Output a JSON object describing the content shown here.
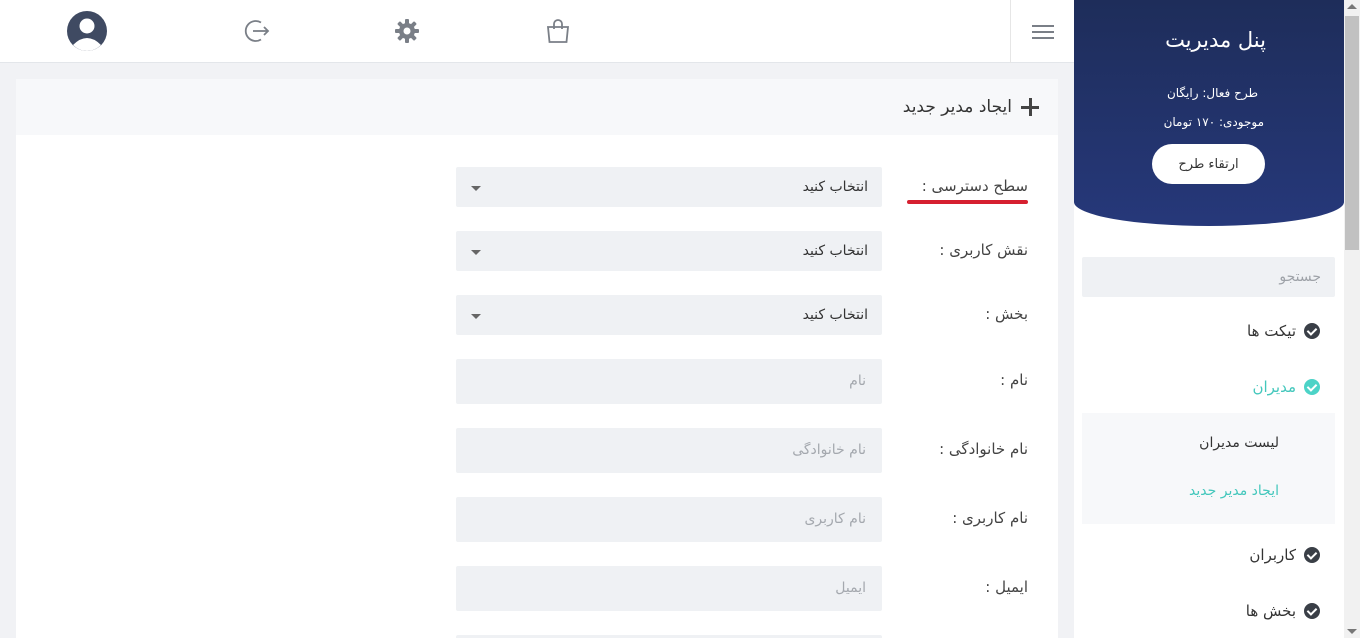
{
  "topbar": {
    "icons": [
      "avatar-icon",
      "logout-icon",
      "gear-icon",
      "shopping-bag-icon",
      "hamburger-icon"
    ]
  },
  "card": {
    "title": "ایجاد مدیر جدید",
    "fields": {
      "access_level": {
        "label": "سطح دسترسی :",
        "value": "انتخاب کنید"
      },
      "user_role": {
        "label": "نقش کاربری :",
        "value": "انتخاب کنید"
      },
      "section": {
        "label": "بخش :",
        "value": "انتخاب کنید"
      },
      "first_name": {
        "label": "نام :",
        "placeholder": "نام"
      },
      "last_name": {
        "label": "نام خانوادگی :",
        "placeholder": "نام خانوادگی"
      },
      "username": {
        "label": "نام کاربری :",
        "placeholder": "نام کاربری"
      },
      "email": {
        "label": "ایمیل :",
        "placeholder": "ایمیل"
      }
    }
  },
  "sidebar": {
    "title": "پنل مدیریت",
    "plan": "طرح فعال: رایگان",
    "balance": "موجودی: ۱۷۰ تومان",
    "upgrade_label": "ارتقاء طرح",
    "search_placeholder": "جستجو",
    "items": {
      "tickets": "تیکت ها",
      "admins": "مدیران",
      "admins_list": "لیست مدیران",
      "create_admin": "ایجاد مدیر جدید",
      "users": "کاربران",
      "sections": "بخش ها"
    }
  },
  "colors": {
    "sidebar_header": "#26387a",
    "accent": "#43c7bc",
    "annotation": "#d62030"
  }
}
